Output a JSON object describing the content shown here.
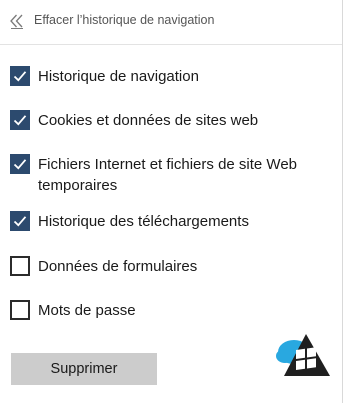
{
  "header": {
    "title": "Effacer l’historique de navigation",
    "back_icon": "double-chevron-left-icon"
  },
  "options": [
    {
      "label": "Historique de navigation",
      "checked": true
    },
    {
      "label": "Cookies et données de sites web",
      "checked": true
    },
    {
      "label": "Fichiers Internet et fichiers de site Web temporaires",
      "checked": true
    },
    {
      "label": "Historique des téléchargements",
      "checked": true
    },
    {
      "label": "Données de formulaires",
      "checked": false
    },
    {
      "label": "Mots de passe",
      "checked": false
    }
  ],
  "actions": {
    "delete_label": "Supprimer"
  },
  "colors": {
    "checkbox_checked": "#2c4a6e",
    "button_bg": "#cccccc"
  },
  "watermark": {
    "icon": "windows-flag-logo-icon"
  }
}
